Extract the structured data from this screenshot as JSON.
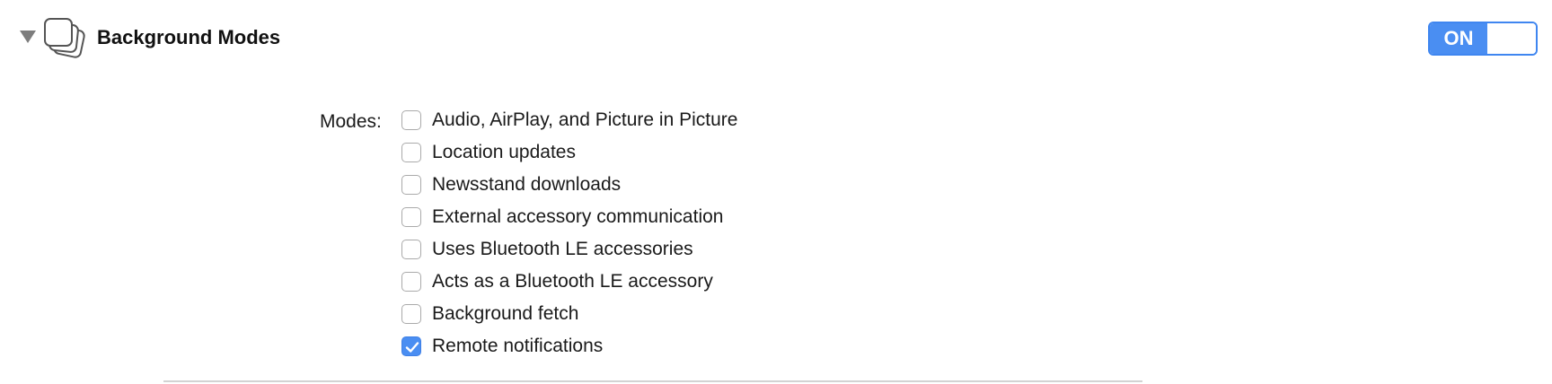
{
  "capability": {
    "title": "Background Modes",
    "icon": "background-modes-icon",
    "expanded": true,
    "toggle": {
      "label": "ON",
      "state": "on",
      "accent_color": "#4a8ef2"
    }
  },
  "modes": {
    "label": "Modes:",
    "items": [
      {
        "label": "Audio, AirPlay, and Picture in Picture",
        "checked": false
      },
      {
        "label": "Location updates",
        "checked": false
      },
      {
        "label": "Newsstand downloads",
        "checked": false
      },
      {
        "label": "External accessory communication",
        "checked": false
      },
      {
        "label": "Uses Bluetooth LE accessories",
        "checked": false
      },
      {
        "label": "Acts as a Bluetooth LE accessory",
        "checked": false
      },
      {
        "label": "Background fetch",
        "checked": false
      },
      {
        "label": "Remote notifications",
        "checked": true
      }
    ]
  }
}
